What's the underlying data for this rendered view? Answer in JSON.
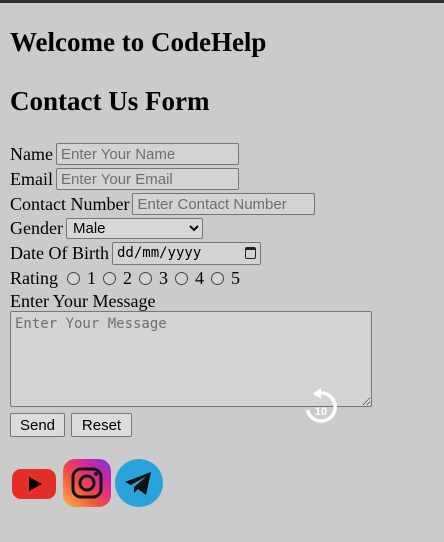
{
  "headings": {
    "welcome": "Welcome to CodeHelp",
    "form_title": "Contact Us Form"
  },
  "form": {
    "name_label": "Name",
    "name_placeholder": "Enter Your Name",
    "email_label": "Email",
    "email_placeholder": "Enter Your Email",
    "contact_label": "Contact Number",
    "contact_placeholder": "Enter Contact Number",
    "gender_label": "Gender",
    "gender_value": "Male",
    "dob_label": "Date Of Birth",
    "dob_placeholder": "dd/mm/yyyy",
    "rating_label": "Rating",
    "rating_options": [
      "1",
      "2",
      "3",
      "4",
      "5"
    ],
    "message_label": "Enter Your Message",
    "message_placeholder": "Enter Your Message",
    "send_label": "Send",
    "reset_label": "Reset"
  },
  "overlay": {
    "replay_seconds": "10"
  },
  "social": [
    {
      "icon": "youtube-icon",
      "color": "#e52d27"
    },
    {
      "icon": "instagram-icon",
      "color": "#d6249f"
    },
    {
      "icon": "telegram-icon",
      "color": "#2aa3dc"
    }
  ],
  "colors": {
    "background": "#cbcbcb",
    "input_bg": "#d3d3d3"
  }
}
